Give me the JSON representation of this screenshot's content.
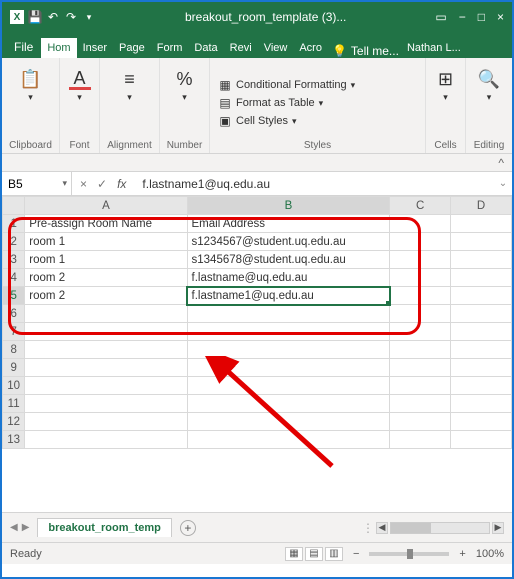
{
  "titlebar": {
    "filename": "breakout_room_template (3)..."
  },
  "menubar": {
    "file": "File",
    "tabs": [
      "Hom",
      "Inser",
      "Page",
      "Form",
      "Data",
      "Revi",
      "View",
      "Acro"
    ],
    "active_tab_index": 0,
    "tell_me": "Tell me...",
    "account": "Nathan L..."
  },
  "ribbon": {
    "groups": {
      "clipboard": {
        "label": "Clipboard",
        "button": ""
      },
      "font": {
        "label": "Font",
        "glyph": "A"
      },
      "alignment": {
        "label": "Alignment"
      },
      "number": {
        "label": "Number",
        "glyph": "%"
      },
      "styles": {
        "label": "Styles",
        "conditional": "Conditional Formatting",
        "table": "Format as Table",
        "cellstyles": "Cell Styles"
      },
      "cells": {
        "label": "Cells"
      },
      "editing": {
        "label": "Editing"
      }
    }
  },
  "formula_bar": {
    "name_box": "B5",
    "formula": "f.lastname1@uq.edu.au"
  },
  "sheet": {
    "columns": [
      "A",
      "B",
      "C",
      "D"
    ],
    "rows": [
      {
        "n": 1,
        "A": "Pre-assign Room Name",
        "B": "Email Address",
        "C": "",
        "D": ""
      },
      {
        "n": 2,
        "A": "room 1",
        "B": "s1234567@student.uq.edu.au",
        "C": "",
        "D": ""
      },
      {
        "n": 3,
        "A": "room 1",
        "B": "s1345678@student.uq.edu.au",
        "C": "",
        "D": ""
      },
      {
        "n": 4,
        "A": "room 2",
        "B": "f.lastname@uq.edu.au",
        "C": "",
        "D": ""
      },
      {
        "n": 5,
        "A": "room 2",
        "B": "f.lastname1@uq.edu.au",
        "C": "",
        "D": ""
      },
      {
        "n": 6,
        "A": "",
        "B": "",
        "C": "",
        "D": ""
      },
      {
        "n": 7,
        "A": "",
        "B": "",
        "C": "",
        "D": ""
      },
      {
        "n": 8,
        "A": "",
        "B": "",
        "C": "",
        "D": ""
      },
      {
        "n": 9,
        "A": "",
        "B": "",
        "C": "",
        "D": ""
      },
      {
        "n": 10,
        "A": "",
        "B": "",
        "C": "",
        "D": ""
      },
      {
        "n": 11,
        "A": "",
        "B": "",
        "C": "",
        "D": ""
      },
      {
        "n": 12,
        "A": "",
        "B": "",
        "C": "",
        "D": ""
      },
      {
        "n": 13,
        "A": "",
        "B": "",
        "C": "",
        "D": ""
      }
    ],
    "selected": {
      "row": 5,
      "col": "B"
    }
  },
  "tabstrip": {
    "sheet_name": "breakout_room_temp"
  },
  "statusbar": {
    "state": "Ready",
    "zoom": "100%"
  }
}
